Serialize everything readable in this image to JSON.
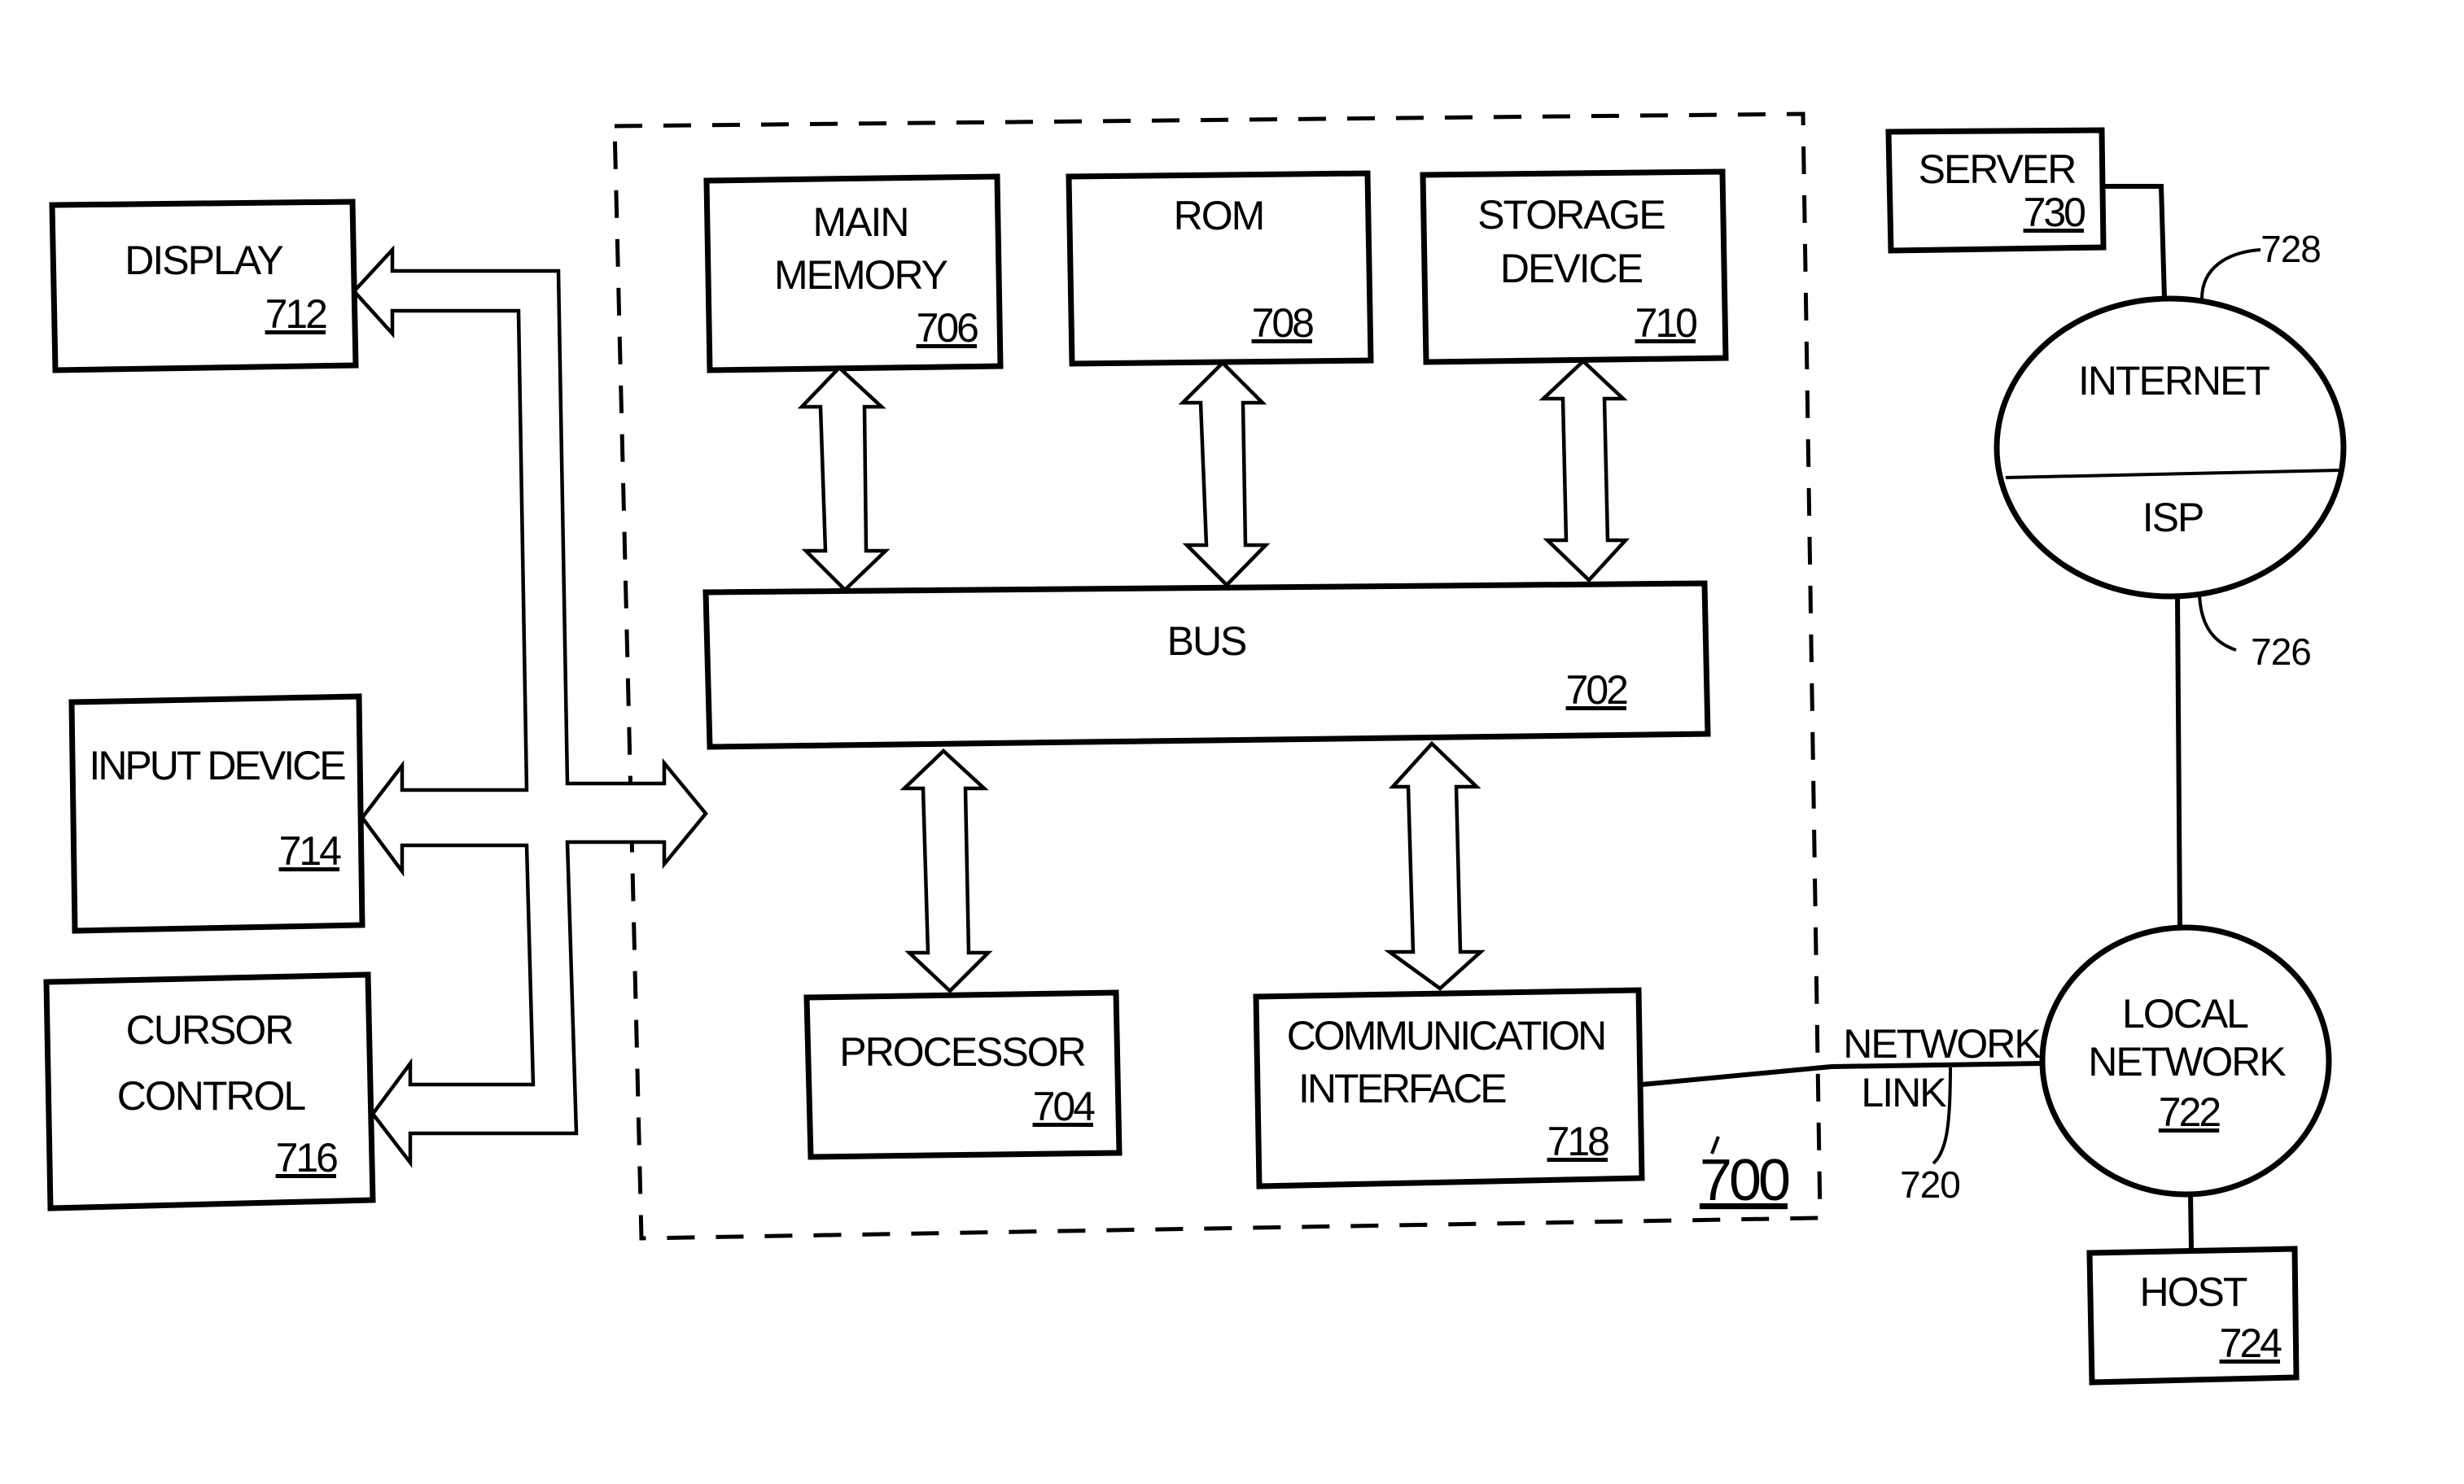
{
  "figure": {
    "system_ref": "700",
    "components": {
      "bus": {
        "label": "BUS",
        "ref": "702"
      },
      "processor": {
        "label": "PROCESSOR",
        "ref": "704"
      },
      "main_memory": {
        "label_lines": [
          "MAIN",
          "MEMORY"
        ],
        "ref": "706"
      },
      "rom": {
        "label": "ROM",
        "ref": "708"
      },
      "storage_device": {
        "label_lines": [
          "STORAGE",
          "DEVICE"
        ],
        "ref": "710"
      },
      "display": {
        "label": "DISPLAY",
        "ref": "712"
      },
      "input_device": {
        "label": "INPUT DEVICE",
        "ref": "714"
      },
      "cursor_control": {
        "label_lines": [
          "CURSOR",
          "CONTROL"
        ],
        "ref": "716"
      },
      "communication_interface": {
        "label_lines": [
          "COMMUNICATION",
          "INTERFACE"
        ],
        "ref": "718"
      },
      "network_link": {
        "label_lines": [
          "NETWORK",
          "LINK"
        ],
        "ref": "720"
      },
      "local_network": {
        "label_lines": [
          "LOCAL",
          "NETWORK"
        ],
        "ref": "722"
      },
      "host": {
        "label": "HOST",
        "ref": "724"
      },
      "isp": {
        "label": "ISP",
        "ref": "726"
      },
      "internet": {
        "label": "INTERNET",
        "ref": "728"
      },
      "server": {
        "label": "SERVER",
        "ref": "730"
      }
    }
  }
}
